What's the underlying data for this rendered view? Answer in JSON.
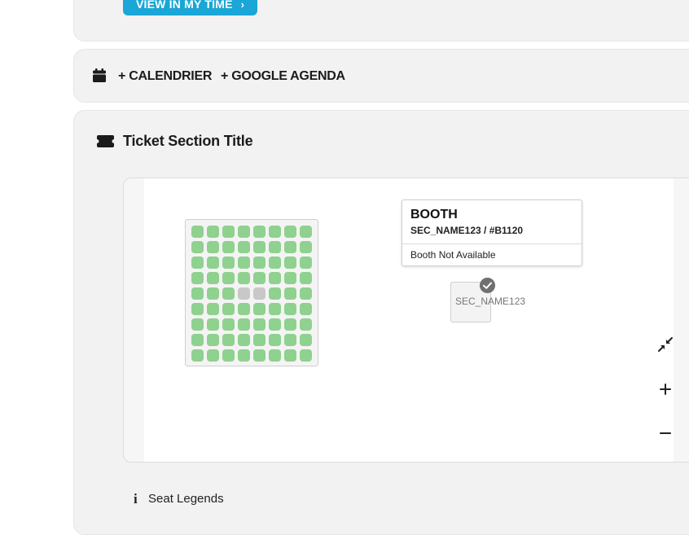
{
  "colors": {
    "accent": "#1aa6d6",
    "seat_available": "#8fd18f",
    "seat_unavailable": "#c8c8c8",
    "card_bg": "#f2f2f2"
  },
  "top_card": {
    "view_button_label": "VIEW IN MY TIME",
    "view_button_icon": "chevron-right-icon"
  },
  "calendar": {
    "icon": "calendar-icon",
    "calendar_link": "+ CALENDRIER",
    "google_link": "+ GOOGLE AGENDA"
  },
  "ticket_section": {
    "icon": "ticket-icon",
    "title": "Ticket Section Title"
  },
  "seat_map": {
    "rows": 9,
    "cols": 8,
    "unavailable_seats": [
      [
        4,
        3
      ],
      [
        4,
        4
      ]
    ],
    "tooltip": {
      "title": "BOOTH",
      "subtitle": "SEC_NAME123 / #B1120",
      "status": "Booth Not Available"
    },
    "booth_label": "SEC_NAME123",
    "controls": {
      "collapse_icon": "collapse-arrows-icon",
      "zoom_in_icon": "plus-icon",
      "zoom_out_icon": "minus-icon"
    }
  },
  "legend": {
    "icon": "info-icon",
    "label": "Seat Legends"
  }
}
